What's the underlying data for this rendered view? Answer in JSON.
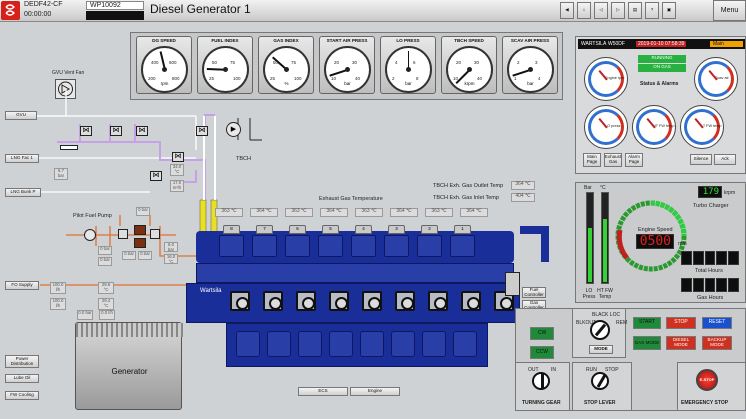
{
  "topbar": {
    "id": "DEDF42-CF",
    "time": "00:00:00",
    "wp": "WP10092",
    "title": "Diesel Generator 1",
    "menu": "Menu"
  },
  "gauges": [
    {
      "label": "DG SPEED",
      "unit": "rpm",
      "ticks": [
        "200",
        "400",
        "600",
        "800"
      ],
      "value": 450
    },
    {
      "label": "FUEL INDEX",
      "unit": "",
      "ticks": [
        "25",
        "50",
        "75",
        "100"
      ],
      "value": 22
    },
    {
      "label": "GAS INDEX",
      "unit": "%",
      "ticks": [
        "25",
        "50",
        "75",
        "100"
      ],
      "value": 40
    },
    {
      "label": "START AIR PRESS",
      "unit": "bar",
      "ticks": [
        "10",
        "20",
        "30",
        "40"
      ],
      "value": 5
    },
    {
      "label": "LO PRESS",
      "unit": "bar",
      "ticks": [
        "2",
        "4",
        "6",
        "8"
      ],
      "value": 5
    },
    {
      "label": "TBCH SPEED",
      "unit": "krpm",
      "ticks": [
        "10",
        "20",
        "30",
        "40"
      ],
      "value": 0
    },
    {
      "label": "SCAV AIR PRESS",
      "unit": "bar",
      "ticks": [
        "1",
        "2",
        "3",
        "4"
      ],
      "value": 0.5
    }
  ],
  "left": {
    "gvu_fan": "GVU Vent Fan",
    "gvu": "GVU",
    "lng_fac": "LNG Fac 1",
    "lng_bunk": "LNG Bunk P",
    "pilot": "Pilot Fuel Pump",
    "fo_supply": "FO Supply",
    "power": "Power Distribution",
    "lube": "Lube Oil",
    "fw": "FW Cooling",
    "generator": "Generator"
  },
  "values": {
    "v1": "6.7 bar",
    "v2": "34.0 °C",
    "v3": "17.0 m³/h",
    "v4": "0 bar",
    "v5": "0 bar",
    "v6": "0 bar",
    "v7": "6.0 bar",
    "v8": "16.0 °C",
    "v9": "0 bar",
    "v10": "0 bar",
    "v11": "100.0 l/h",
    "v12": "29.6 °C",
    "v13": "100.0 l/h",
    "v14": "29.4 °C",
    "v15": "0.0 bar",
    "v16": "0.0 l/h",
    "v17": "0.0 bar",
    "v18": "0.0 l/h"
  },
  "tbch": "TBCH",
  "exhaust": {
    "label": "Exhaust Gas Temperature",
    "outlet_label": "TBCH Exh. Gas Outlet Temp",
    "outlet": "364 ℃",
    "inlet_label": "TBCH Exh. Gas Inlet Temp",
    "inlet": "404 ℃",
    "cyl_temps": [
      "363 ℃",
      "364 ℃",
      "363 ℃",
      "364 ℃",
      "363 ℃",
      "364 ℃",
      "363 ℃",
      "364 ℃"
    ],
    "cyl_nums": [
      "8",
      "7",
      "6",
      "5",
      "4",
      "3",
      "2",
      "1"
    ]
  },
  "engine": {
    "brand": "Wartsila",
    "ecs": "ECS",
    "engine": "Engine",
    "fuel_ctrl": "Fuel Controller",
    "gas_ctrl": "Gas Controller"
  },
  "status": {
    "logo": "WARTSILA",
    "model": "W50DF",
    "datetime": "2019-01-10 07:58:39",
    "main": "Main",
    "running": "RUNNING",
    "gas": "ON GAS",
    "title": "Status & Alarms",
    "tabs": [
      "Main Page",
      "Exhaust Gas",
      "Alarm Page"
    ],
    "silence": "Silence",
    "ack": "Ack"
  },
  "mini": {
    "rpm": "Engine rpm",
    "lo": "LO press",
    "htfw": "HT FW temp",
    "ltfw": "LT FW temp",
    "scav": "Scav air"
  },
  "speed": {
    "bar_lbl": "Bar",
    "deg": "°C",
    "lo": "LO Press",
    "htfw": "HT FW Temp",
    "tc_val": "179",
    "tc_unit": "krpm",
    "tc_lbl": "Turbo Charger",
    "engine_speed": "Engine Speed",
    "rpm_val": "0500",
    "rpm": "rpm",
    "total_hours": "Total Hours",
    "gas_hours": "Gas Hours"
  },
  "controls": {
    "start": "START",
    "stop": "STOP",
    "reset": "RESET",
    "gas": "GAS MODE",
    "diesel": "DIESEL MODE",
    "backup": "BACKUP MODE",
    "cw": "CW",
    "ccw": "CCW",
    "turning": "TURNING GEAR",
    "out": "OUT",
    "in": "IN",
    "blk_loc": "BLACK LOC",
    "blkout": "BLKOUT",
    "rem": "REM",
    "mode": "MODE",
    "run": "RUN",
    "stop_l": "STOP",
    "stop_lever": "STOP LEVER",
    "emg": "E-STOP",
    "emg_stop": "EMERGENCY STOP"
  },
  "colors": {
    "engine": "#1a2e9a",
    "red": "#d03020",
    "green": "#1e8a3a",
    "blue": "#1a4fd0"
  }
}
